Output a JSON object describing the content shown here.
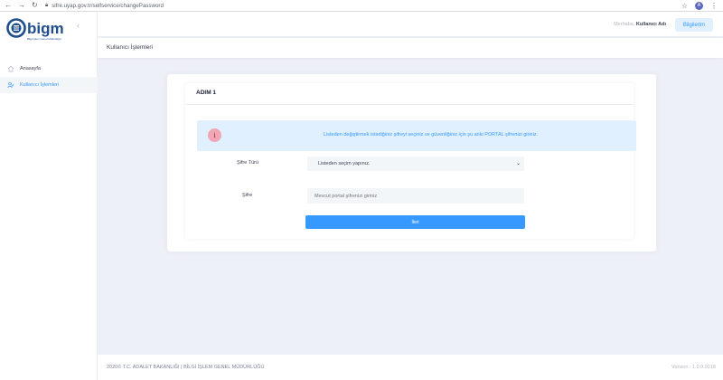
{
  "browser": {
    "url": "sifre.uyap.gov.tr/selfservice/changePassword",
    "profile_initial": "A"
  },
  "logo": {
    "brand": "bigm",
    "tagline": "Bilgi İşlem Genel Müdürlüğü"
  },
  "sidebar": {
    "items": [
      {
        "label": "Anasayfa",
        "icon": "home-icon"
      },
      {
        "label": "Kullanıcı İşlemleri",
        "icon": "user-edit-icon",
        "active": true
      }
    ]
  },
  "header": {
    "greeting": "Merhaba,",
    "username": "Kullanıcı Adı",
    "info_button": "Bilgilerim"
  },
  "subheader": {
    "title": "Kullanıcı İşlemleri"
  },
  "step": {
    "title": "ADIM 1",
    "alert": "Listeden değiştirmek istediğiniz şifreyi seçiniz ve güvenliğiniz için şu anki PORTAL şifrenizi giriniz.",
    "password_type_label": "Şifre Türü",
    "password_type_value": "Listeden seçim yapınız.",
    "password_label": "Şifre",
    "password_placeholder": "Mevcut portal şifrenizi giriniz",
    "next_button": "İleri"
  },
  "footer": {
    "copyright": "2020© T.C. ADALET BAKANLIĞI | BİLGİ İŞLEM GENEL MÜDÜRLÜĞÜ",
    "version": "Version : 1.0.0.9218"
  },
  "colors": {
    "accent": "#3699ff",
    "alert_bg": "#e1f0ff",
    "logo_blue": "#1f4e8c"
  }
}
